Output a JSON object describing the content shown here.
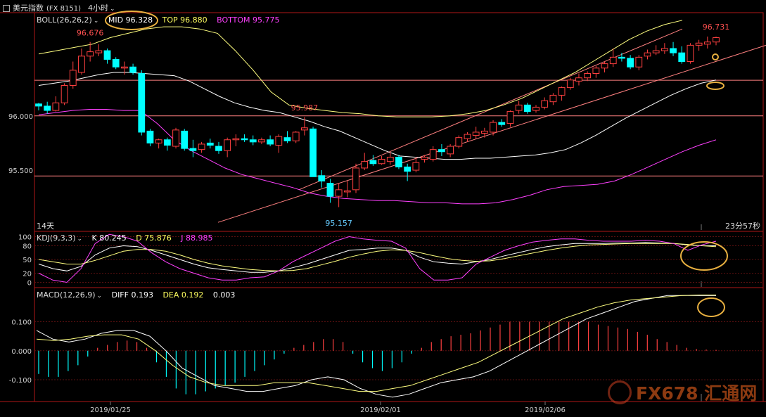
{
  "window": {
    "title": "美元指数",
    "symbol": "(FX 8151)",
    "period": "4小时",
    "period_menu_icon": "chevron-down-icon"
  },
  "boll": {
    "label": "BOLL(26,26,2)",
    "mid": "MID 96.328",
    "top": "TOP 96.880",
    "bottom": "BOTTOM 95.775"
  },
  "kdj": {
    "label": "KDJ(9,3,3)",
    "k": "K 80.245",
    "d": "D 75.876",
    "j": "J 88.985"
  },
  "macd": {
    "label": "MACD(12,26,9)",
    "diff": "DIFF 0.193",
    "dea": "DEA 0.192",
    "hist": "0.003"
  },
  "main_labels": {
    "days": "14天",
    "countdown": "23分57秒",
    "hi1": "96.676",
    "hi2": "95.987",
    "lo1": "95.157",
    "hi3": "96.731"
  },
  "watermark": "FX678 汇通网",
  "colors": {
    "up": "#ff4040",
    "down": "#00ffff",
    "mid": "#ffffff",
    "top": "#ffff80",
    "bottom": "#ff40ff",
    "channel": "#ff8080",
    "highlight": "#e8b040"
  },
  "chart_data": [
    {
      "type": "candlestick",
      "title": "美元指数 (FX 8151) 4小时",
      "yticks": [
        "96.000",
        "95.500"
      ],
      "ylim": [
        94.95,
        96.95
      ],
      "xticks": [
        "2019/01/25",
        "2019/02/01",
        "2019/02/06"
      ],
      "ohlc": [
        [
          96.11,
          96.12,
          96.05,
          96.09
        ],
        [
          96.09,
          96.13,
          96.02,
          96.05
        ],
        [
          96.05,
          96.18,
          96.04,
          96.12
        ],
        [
          96.12,
          96.3,
          96.1,
          96.28
        ],
        [
          96.28,
          96.5,
          96.25,
          96.42
        ],
        [
          96.4,
          96.62,
          96.38,
          96.55
        ],
        [
          96.55,
          96.68,
          96.5,
          96.59
        ],
        [
          96.58,
          96.66,
          96.55,
          96.6
        ],
        [
          96.6,
          96.62,
          96.48,
          96.52
        ],
        [
          96.52,
          96.54,
          96.43,
          96.45
        ],
        [
          96.44,
          96.5,
          96.38,
          96.45
        ],
        [
          96.45,
          96.48,
          96.38,
          96.4
        ],
        [
          96.39,
          96.42,
          95.82,
          95.85
        ],
        [
          95.86,
          95.88,
          95.72,
          95.75
        ],
        [
          95.75,
          95.79,
          95.7,
          95.78
        ],
        [
          95.78,
          95.8,
          95.68,
          95.73
        ],
        [
          95.72,
          95.89,
          95.7,
          95.87
        ],
        [
          95.86,
          95.88,
          95.68,
          95.7
        ],
        [
          95.7,
          95.78,
          95.62,
          95.68
        ],
        [
          95.69,
          95.76,
          95.66,
          95.74
        ],
        [
          95.75,
          95.79,
          95.7,
          95.73
        ],
        [
          95.72,
          95.76,
          95.65,
          95.68
        ],
        [
          95.68,
          95.8,
          95.62,
          95.78
        ],
        [
          95.78,
          95.83,
          95.72,
          95.79
        ],
        [
          95.79,
          95.83,
          95.76,
          95.78
        ],
        [
          95.78,
          95.82,
          95.73,
          95.76
        ],
        [
          95.76,
          95.8,
          95.74,
          95.78
        ],
        [
          95.78,
          95.82,
          95.72,
          95.74
        ],
        [
          95.73,
          95.83,
          95.66,
          95.81
        ],
        [
          95.8,
          95.86,
          95.75,
          95.77
        ],
        [
          95.77,
          95.86,
          95.75,
          95.85
        ],
        [
          95.87,
          95.99,
          95.82,
          95.89
        ],
        [
          95.88,
          95.9,
          95.44,
          95.44
        ],
        [
          95.45,
          95.5,
          95.34,
          95.4
        ],
        [
          95.38,
          95.42,
          95.2,
          95.26
        ],
        [
          95.26,
          95.38,
          95.16,
          95.32
        ],
        [
          95.3,
          95.4,
          95.25,
          95.31
        ],
        [
          95.32,
          95.56,
          95.29,
          95.52
        ],
        [
          95.52,
          95.66,
          95.5,
          95.58
        ],
        [
          95.59,
          95.64,
          95.54,
          95.56
        ],
        [
          95.56,
          95.63,
          95.55,
          95.6
        ],
        [
          95.58,
          95.67,
          95.55,
          95.62
        ],
        [
          95.62,
          95.64,
          95.51,
          95.53
        ],
        [
          95.53,
          95.56,
          95.4,
          95.49
        ],
        [
          95.5,
          95.62,
          95.48,
          95.57
        ],
        [
          95.6,
          95.64,
          95.57,
          95.62
        ],
        [
          95.6,
          95.72,
          95.58,
          95.69
        ],
        [
          95.69,
          95.74,
          95.63,
          95.67
        ],
        [
          95.65,
          95.74,
          95.62,
          95.72
        ],
        [
          95.72,
          95.82,
          95.7,
          95.8
        ],
        [
          95.79,
          95.85,
          95.76,
          95.83
        ],
        [
          95.82,
          95.9,
          95.79,
          95.85
        ],
        [
          95.84,
          95.89,
          95.8,
          95.86
        ],
        [
          95.85,
          95.96,
          95.82,
          95.94
        ],
        [
          95.94,
          95.97,
          95.9,
          95.92
        ],
        [
          95.93,
          96.05,
          95.9,
          96.04
        ],
        [
          96.05,
          96.14,
          96.02,
          96.1
        ],
        [
          96.1,
          96.12,
          96.02,
          96.04
        ],
        [
          96.05,
          96.1,
          96.03,
          96.08
        ],
        [
          96.08,
          96.17,
          96.06,
          96.14
        ],
        [
          96.13,
          96.21,
          96.1,
          96.19
        ],
        [
          96.19,
          96.27,
          96.14,
          96.26
        ],
        [
          96.26,
          96.35,
          96.24,
          96.33
        ],
        [
          96.32,
          96.39,
          96.28,
          96.35
        ],
        [
          96.35,
          96.41,
          96.32,
          96.39
        ],
        [
          96.39,
          96.46,
          96.35,
          96.44
        ],
        [
          96.44,
          96.5,
          96.4,
          96.48
        ],
        [
          96.48,
          96.62,
          96.45,
          96.54
        ],
        [
          96.54,
          96.58,
          96.5,
          96.53
        ],
        [
          96.53,
          96.56,
          96.43,
          96.45
        ],
        [
          96.45,
          96.56,
          96.42,
          96.54
        ],
        [
          96.55,
          96.61,
          96.52,
          96.58
        ],
        [
          96.58,
          96.65,
          96.56,
          96.6
        ],
        [
          96.6,
          96.67,
          96.57,
          96.62
        ],
        [
          96.62,
          96.68,
          96.55,
          96.58
        ],
        [
          96.58,
          96.64,
          96.48,
          96.5
        ],
        [
          96.5,
          96.67,
          96.48,
          96.65
        ],
        [
          96.65,
          96.7,
          96.6,
          96.67
        ],
        [
          96.66,
          96.73,
          96.62,
          96.68
        ],
        [
          96.68,
          96.73,
          96.65,
          96.72
        ]
      ],
      "boll_mid": [
        96.28,
        96.3,
        96.32,
        96.35,
        96.38,
        96.4,
        96.4,
        96.39,
        96.38,
        96.37,
        96.32,
        96.25,
        96.18,
        96.12,
        96.08,
        96.05,
        96.03,
        95.99,
        95.95,
        95.9,
        95.86,
        95.8,
        95.74,
        95.68,
        95.63,
        95.62,
        95.61,
        95.6,
        95.6,
        95.61,
        95.61,
        95.62,
        95.63,
        95.64,
        95.66,
        95.69,
        95.75,
        95.82,
        95.9,
        95.98,
        96.05,
        96.12,
        96.19,
        96.25,
        96.3,
        96.33
      ],
      "boll_top": [
        96.57,
        96.6,
        96.63,
        96.66,
        96.72,
        96.76,
        96.8,
        96.82,
        96.82,
        96.8,
        96.76,
        96.6,
        96.42,
        96.22,
        96.1,
        96.07,
        96.05,
        96.03,
        96.02,
        96.0,
        95.99,
        95.99,
        95.99,
        96.0,
        96.02,
        96.05,
        96.1,
        96.16,
        96.24,
        96.32,
        96.4,
        96.5,
        96.6,
        96.7,
        96.78,
        96.84,
        96.88
      ],
      "boll_bottom": [
        96.01,
        96.03,
        96.05,
        96.06,
        96.06,
        96.05,
        96.05,
        95.93,
        95.78,
        95.68,
        95.6,
        95.52,
        95.46,
        95.42,
        95.38,
        95.34,
        95.29,
        95.26,
        95.24,
        95.23,
        95.22,
        95.22,
        95.21,
        95.2,
        95.2,
        95.19,
        95.19,
        95.2,
        95.23,
        95.27,
        95.32,
        95.35,
        95.36,
        95.37,
        95.4,
        95.46,
        95.53,
        95.6,
        95.67,
        95.73,
        95.78
      ],
      "channel": [
        [
          95.02,
          95.32
        ],
        [
          96.65,
          96.8
        ]
      ],
      "hlines": [
        96.328,
        96.0,
        95.447
      ],
      "annotations": [
        {
          "label": "96.676",
          "x": 6,
          "y": 96.676
        },
        {
          "label": "95.987",
          "x": 31,
          "y": 95.987
        },
        {
          "label": "95.157",
          "x": 35,
          "y": 95.157
        },
        {
          "label": "96.731",
          "x": 79,
          "y": 96.731
        }
      ]
    },
    {
      "type": "line",
      "title": "KDJ(9,3,3)",
      "yticks": [
        "100",
        "80",
        "50",
        "20",
        "0"
      ],
      "ylim": [
        -10,
        110
      ],
      "series": [
        {
          "name": "K",
          "values": [
            40,
            30,
            25,
            35,
            60,
            75,
            80,
            78,
            70,
            60,
            50,
            40,
            32,
            28,
            25,
            22,
            22,
            25,
            32,
            40,
            50,
            60,
            70,
            72,
            75,
            75,
            70,
            55,
            45,
            42,
            40,
            45,
            50,
            58,
            65,
            72,
            78,
            82,
            85,
            85,
            85,
            86,
            86,
            87,
            86,
            85,
            82,
            80,
            80
          ]
        },
        {
          "name": "D",
          "values": [
            50,
            45,
            40,
            40,
            48,
            58,
            68,
            72,
            72,
            68,
            60,
            50,
            42,
            36,
            32,
            28,
            26,
            25,
            26,
            30,
            38,
            46,
            55,
            62,
            68,
            71,
            70,
            65,
            58,
            52,
            48,
            46,
            47,
            52,
            58,
            64,
            70,
            75,
            79,
            82,
            83,
            84,
            85,
            85,
            85,
            85,
            83,
            80,
            78
          ]
        },
        {
          "name": "J",
          "values": [
            20,
            5,
            0,
            30,
            85,
            105,
            100,
            90,
            65,
            45,
            30,
            20,
            10,
            5,
            5,
            10,
            12,
            25,
            45,
            60,
            75,
            90,
            100,
            95,
            92,
            90,
            75,
            30,
            5,
            5,
            10,
            40,
            55,
            70,
            80,
            88,
            92,
            95,
            95,
            92,
            90,
            90,
            90,
            92,
            90,
            85,
            70,
            82,
            90
          ]
        }
      ]
    },
    {
      "type": "bar",
      "title": "MACD(12,26,9)",
      "yticks": [
        "0.100",
        "0.000",
        "-0.100"
      ],
      "ylim": [
        -0.175,
        0.215
      ],
      "histogram": [
        -0.08,
        -0.09,
        -0.09,
        -0.07,
        -0.05,
        -0.02,
        0.01,
        0.02,
        0.03,
        0.035,
        0.03,
        0.01,
        -0.04,
        -0.09,
        -0.13,
        -0.15,
        -0.15,
        -0.14,
        -0.13,
        -0.12,
        -0.11,
        -0.09,
        -0.07,
        -0.05,
        -0.03,
        -0.01,
        0.01,
        0.02,
        0.03,
        0.04,
        0.04,
        0.03,
        -0.01,
        -0.04,
        -0.06,
        -0.07,
        -0.06,
        -0.04,
        -0.01,
        0.01,
        0.03,
        0.04,
        0.05,
        0.055,
        0.06,
        0.07,
        0.08,
        0.09,
        0.1,
        0.1,
        0.1,
        0.1,
        0.1,
        0.1,
        0.1,
        0.1,
        0.1,
        0.09,
        0.085,
        0.08,
        0.075,
        0.065,
        0.055,
        0.04,
        0.03,
        0.02,
        0.01,
        0.006,
        0.004,
        0.003
      ],
      "diff": [
        0.07,
        0.04,
        0.03,
        0.04,
        0.06,
        0.07,
        0.07,
        0.05,
        0.0,
        -0.06,
        -0.09,
        -0.12,
        -0.13,
        -0.14,
        -0.14,
        -0.13,
        -0.12,
        -0.1,
        -0.09,
        -0.1,
        -0.13,
        -0.15,
        -0.16,
        -0.15,
        -0.13,
        -0.11,
        -0.1,
        -0.09,
        -0.07,
        -0.04,
        -0.01,
        0.02,
        0.05,
        0.08,
        0.11,
        0.13,
        0.15,
        0.17,
        0.18,
        0.19,
        0.19,
        0.19,
        0.19
      ],
      "dea": [
        0.04,
        0.035,
        0.04,
        0.05,
        0.055,
        0.055,
        0.04,
        0.0,
        -0.05,
        -0.09,
        -0.11,
        -0.12,
        -0.12,
        -0.12,
        -0.11,
        -0.11,
        -0.11,
        -0.12,
        -0.13,
        -0.14,
        -0.14,
        -0.13,
        -0.12,
        -0.1,
        -0.08,
        -0.06,
        -0.04,
        -0.01,
        0.02,
        0.05,
        0.08,
        0.11,
        0.13,
        0.15,
        0.165,
        0.175,
        0.18,
        0.185,
        0.19,
        0.192,
        0.192
      ]
    }
  ]
}
